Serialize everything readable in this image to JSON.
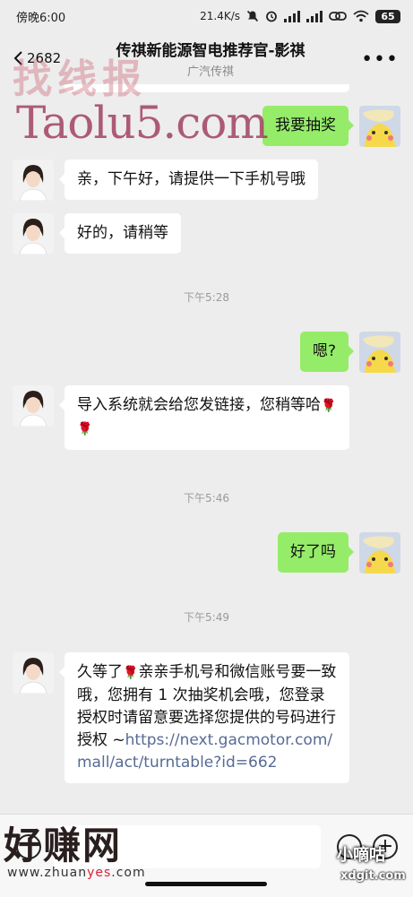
{
  "status_bar": {
    "time": "傍晚6:00",
    "network_speed": "21.4K/s",
    "battery": "65",
    "icons": [
      "mute-icon",
      "alarm-icon",
      "signal-icon",
      "signal-icon",
      "link-icon",
      "wifi-icon",
      "battery-icon"
    ]
  },
  "header": {
    "back_count": "2682",
    "title": "传祺新能源智电推荐官-影祺",
    "subtitle": "广汽传祺",
    "more_label": "•••"
  },
  "messages": [
    {
      "side": "right",
      "text": "我要抽奖"
    },
    {
      "side": "left",
      "text": "亲，下午好，请提供一下手机号哦"
    },
    {
      "side": "left",
      "text": "好的，请稍等"
    },
    {
      "type": "time",
      "text": "下午5:28"
    },
    {
      "side": "right",
      "text": "嗯?"
    },
    {
      "side": "left",
      "text": "导入系统就会给您发链接，您稍等哈"
    },
    {
      "type": "time",
      "text": "下午5:46"
    },
    {
      "side": "right",
      "text": "好了吗"
    },
    {
      "type": "time",
      "text": "下午5:49"
    },
    {
      "side": "left",
      "text_before": "久等了",
      "text_after": "亲亲手机号和微信账号要一致哦，您拥有 1 次抽奖机会哦，您登录授权时请留意要选择您提供的号码进行授权 ~",
      "link": "https://next.gacmotor.com/mall/act/turntable?id=662"
    }
  ],
  "watermarks": {
    "top": "找线报",
    "taolu": "Taolu5.com",
    "bottom": "好赚网",
    "bottom_url_a": "www.zhuan",
    "bottom_url_b": "yes",
    "bottom_url_c": ".com",
    "bottom_right": "小嘀咕",
    "bottom_right_url": "xdgit.com"
  },
  "colors": {
    "background": "#ededed",
    "bubble_self": "#95ec69",
    "bubble_other": "#ffffff",
    "link": "#576b95"
  }
}
